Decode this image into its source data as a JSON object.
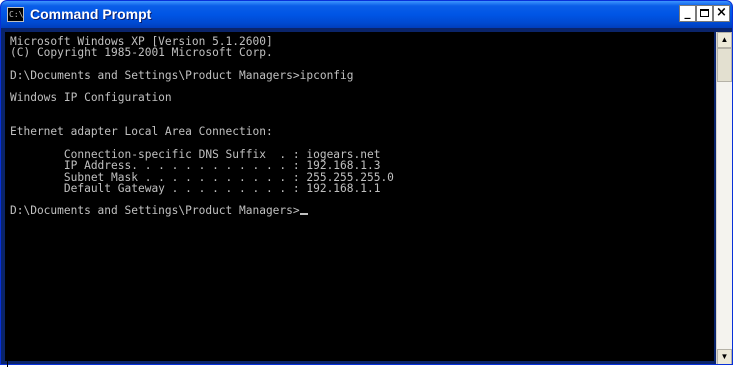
{
  "window": {
    "title": "Command Prompt",
    "icon_glyph": "C:\\"
  },
  "controls": {
    "minimize": "_",
    "close": "×"
  },
  "console": {
    "lines": [
      "Microsoft Windows XP [Version 5.1.2600]",
      "(C) Copyright 1985-2001 Microsoft Corp.",
      "",
      "D:\\Documents and Settings\\Product Managers>ipconfig",
      "",
      "Windows IP Configuration",
      "",
      "",
      "Ethernet adapter Local Area Connection:",
      "",
      "        Connection-specific DNS Suffix  . : iogears.net",
      "        IP Address. . . . . . . . . . . . : 192.168.1.3",
      "        Subnet Mask . . . . . . . . . . . : 255.255.255.0",
      "        Default Gateway . . . . . . . . . : 192.168.1.1",
      "",
      "D:\\Documents and Settings\\Product Managers>"
    ]
  },
  "scrollbar": {
    "up_glyph": "▲",
    "down_glyph": "▼"
  },
  "colors": {
    "titlebar": "#0055e5",
    "console_bg": "#000000",
    "console_text": "#c0c0c0"
  }
}
